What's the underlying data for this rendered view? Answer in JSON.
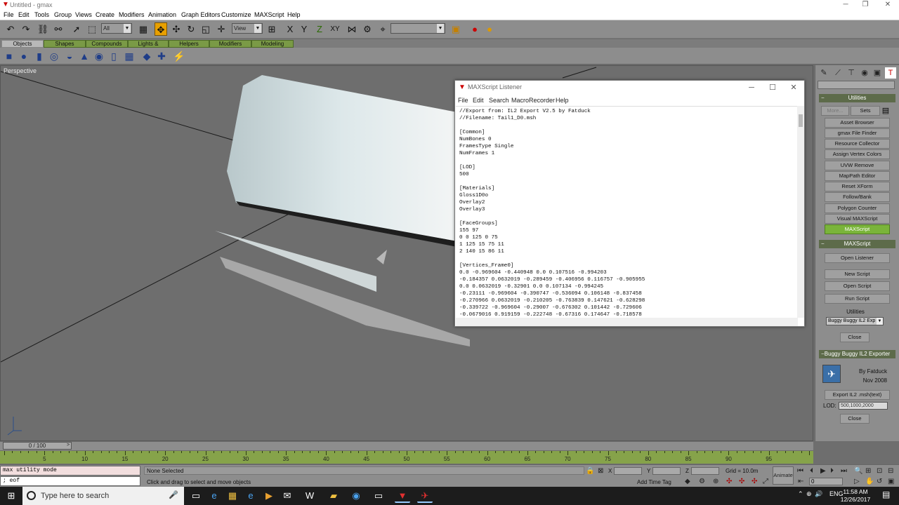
{
  "window": {
    "title": "Untitled - gmax",
    "minimize": "─",
    "restore": "❐",
    "close": "✕"
  },
  "menubar": [
    "File",
    "Edit",
    "Tools",
    "Group",
    "Views",
    "Create",
    "Modifiers",
    "Animation",
    "Graph Editors",
    "Customize",
    "MAXScript",
    "Help"
  ],
  "toolbar1": {
    "selection_filter": "All",
    "ref_coord": "View",
    "named_selection": ""
  },
  "tabs": [
    "Objects",
    "Shapes",
    "Compounds",
    "Lights & Cameras",
    "Helpers",
    "Modifiers",
    "Modeling"
  ],
  "viewport": {
    "label": "Perspective"
  },
  "listener": {
    "title": "MAXScript Listener",
    "menu": [
      "File",
      "Edit",
      "Search",
      "MacroRecorder",
      "Help"
    ],
    "lines": [
      "//Export from: IL2 Export V2.5 by Fatduck",
      "//Filename: Tail1_D0.msh",
      "",
      "[Common]",
      "NumBones 0",
      "FramesType Single",
      "NumFrames 1",
      "",
      "[LOD]",
      "500",
      "",
      "[Materials]",
      "Gloss1D0o",
      "Overlay2",
      "Overlay3",
      "",
      "[FaceGroups]",
      "155 97",
      "0 0 125 0 75",
      "1 125 15 75 11",
      "2 140 15 86 11",
      "",
      "[Vertices_Frame0]",
      "0.0 -0.969604 -0.440948 0.0 0.107516 -0.994203",
      "-0.184357 0.0632019 -0.289459 -0.406956 0.116757 -0.905955",
      "0.0 0.0632019 -0.32901 0.0 0.107134 -0.994245",
      "-0.23111 -0.969604 -0.390747 -0.536094 0.106148 -0.837458",
      "-0.270966 0.0632019 -0.210205 -0.763839 0.147621 -0.628298",
      "-0.339722 -0.969604 -0.29007 -0.676302 0.101442 -0.729606",
      "-0.0679016 0.919159 -0.222748 -0.67316 0.174647 -0.718578"
    ]
  },
  "command_panel": {
    "utilities_header": "Utilities",
    "more_label": "More...",
    "sets_label": "Sets",
    "utility_buttons": [
      "Asset Browser",
      "gmax File Finder",
      "Resource Collector",
      "Assign Vertex Colors",
      "UVW Remove",
      "MapPath Editor",
      "Reset XForm",
      "Follow/Bank",
      "Polygon Counter",
      "Visual MAXScript",
      "MAXScript"
    ],
    "maxscript_header": "MAXScript",
    "open_listener": "Open Listener",
    "new_script": "New Script",
    "open_script": "Open Script",
    "run_script": "Run Script",
    "utilities_label": "Utilities",
    "utility_dropdown": "Buggy Buggy IL2 Exp",
    "close_label": "Close",
    "exporter_header": "Buggy Buggy IL2 Exporter",
    "by_line": "By Fatduck",
    "date_line": "Nov 2008",
    "export_button": "Export IL2 .msh(text)",
    "lod_label": "LOD:",
    "lod_value": "500,1000,2000",
    "close2_label": "Close"
  },
  "timeline": {
    "frame_display": "0 / 100",
    "ruler_labels": [
      "0",
      "5",
      "10",
      "15",
      "20",
      "25",
      "30",
      "35",
      "40",
      "45",
      "50",
      "55",
      "60",
      "65",
      "70",
      "75",
      "80",
      "85",
      "90",
      "95",
      "100"
    ]
  },
  "status": {
    "macro_line1": "max utility mode",
    "macro_line2": "; eof",
    "selection": "None Selected",
    "prompt": "Click and drag to select and move objects",
    "x_label": "X",
    "y_label": "Y",
    "z_label": "Z",
    "grid": "Grid = 10.0m",
    "add_time_tag": "Add Time Tag",
    "animate": "Animate",
    "frame_field": "0"
  },
  "taskbar": {
    "search_placeholder": "Type here to search",
    "lang": "ENG",
    "time": "11:58 AM",
    "date": "12/26/2017"
  }
}
